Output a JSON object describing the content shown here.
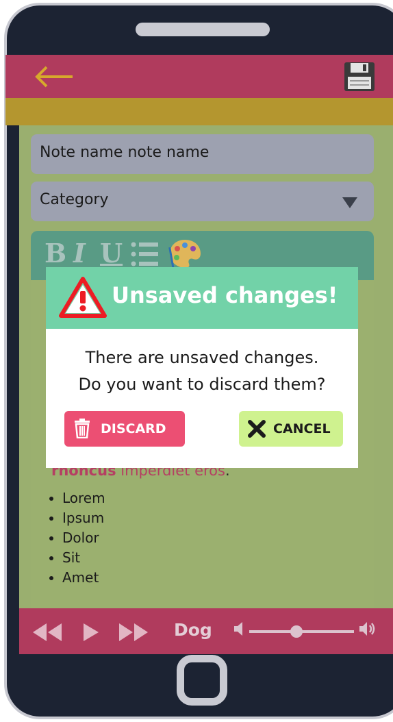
{
  "header": {
    "back_icon": "back-arrow-icon",
    "save_icon": "floppy-disk-icon"
  },
  "form": {
    "note_name_value": "Note name note name",
    "category_value": "Category"
  },
  "toolbar": {
    "bold_label": "B",
    "italic_label": "I",
    "underline_label": "U",
    "list_icon": "list-icon",
    "palette_icon": "palette-icon"
  },
  "editor": {
    "partial_bold_word": "rhoncus",
    "partial_rest": " imperdiet eros",
    "partial_end": ".",
    "bullets": [
      "Lorem",
      "Ipsum",
      "Dolor",
      "Sit",
      "Amet"
    ]
  },
  "player": {
    "rewind_icon": "rewind-icon",
    "play_icon": "play-icon",
    "forward_icon": "fast-forward-icon",
    "track_name": "Dog",
    "volume_low_icon": "volume-low-icon",
    "volume_high_icon": "volume-high-icon",
    "volume_level": 0.45
  },
  "dialog": {
    "title": "Unsaved changes!",
    "message_line1": "There are unsaved changes.",
    "message_line2": "Do you want to discard them?",
    "discard_label": "DISCARD",
    "cancel_label": "CANCEL",
    "warning_icon": "warning-icon",
    "trash_icon": "trash-icon",
    "close_icon": "x-icon"
  },
  "colors": {
    "header_bg": "#b03b5d",
    "accent_bar": "#b4962f",
    "dialog_header": "#72d2a8",
    "discard_bg": "#ec4f73",
    "cancel_bg": "#cff28f"
  }
}
